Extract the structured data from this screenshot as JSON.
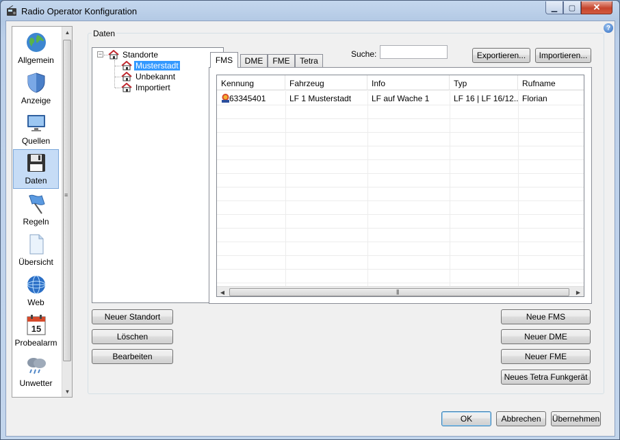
{
  "window": {
    "title": "Radio Operator Konfiguration"
  },
  "sidebar": {
    "items": [
      {
        "label": "Allgemein",
        "icon": "globe-icon"
      },
      {
        "label": "Anzeige",
        "icon": "shield-icon"
      },
      {
        "label": "Quellen",
        "icon": "monitor-icon"
      },
      {
        "label": "Daten",
        "icon": "floppy-disk-icon",
        "selected": true
      },
      {
        "label": "Regeln",
        "icon": "flag-icon"
      },
      {
        "label": "Übersicht",
        "icon": "document-icon"
      },
      {
        "label": "Web",
        "icon": "web-globe-icon"
      },
      {
        "label": "Probealarm",
        "icon": "calendar-icon",
        "calendar_day": "15"
      },
      {
        "label": "Unwetter",
        "icon": "storm-cloud-icon"
      }
    ]
  },
  "group": {
    "title": "Daten"
  },
  "tree": {
    "root": "Standorte",
    "children": [
      "Musterstadt",
      "Unbekannt",
      "Importiert"
    ],
    "selected": "Musterstadt"
  },
  "tabs": [
    {
      "label": "FMS",
      "active": true
    },
    {
      "label": "DME"
    },
    {
      "label": "FME"
    },
    {
      "label": "Tetra"
    }
  ],
  "search": {
    "label": "Suche:",
    "value": ""
  },
  "toolbar": {
    "export_label": "Exportieren...",
    "import_label": "Importieren..."
  },
  "table": {
    "columns": [
      "Kennung",
      "Fahrzeug",
      "Info",
      "Typ",
      "Rufname"
    ],
    "rows": [
      {
        "kennung": "63345401",
        "fahrzeug": "LF 1 Musterstadt",
        "info": "LF auf Wache 1",
        "typ": "LF 16 | LF 16/12...",
        "rufname": "Florian"
      }
    ]
  },
  "left_buttons": {
    "new_location": "Neuer Standort",
    "delete": "Löschen",
    "edit": "Bearbeiten"
  },
  "right_buttons": {
    "new_fms": "Neue FMS",
    "new_dme": "Neuer DME",
    "new_fme": "Neuer FME",
    "new_tetra": "Neues Tetra Funkgerät"
  },
  "footer": {
    "ok": "OK",
    "cancel": "Abbrechen",
    "apply": "Übernehmen"
  },
  "colors": {
    "selection": "#3399ff",
    "nav_selected": "#c6dcf6",
    "titlebar": "#b9cde6"
  }
}
